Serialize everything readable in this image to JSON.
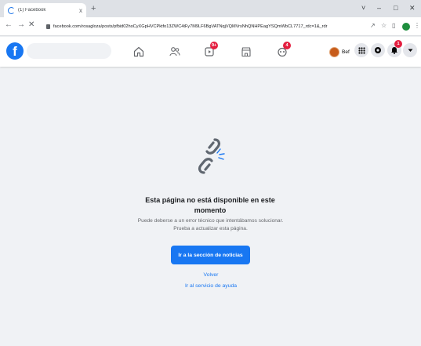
{
  "browser": {
    "tab_title": "(1) Facebook",
    "tab_close": "x",
    "new_tab": "+",
    "url": "facebook.com/rosagloza/posts/pfbid02hoCyXGpHVCPktfo13ZWC4tFy7M9LF6BgVATNqjVQMVrsNhQNHPEagYSQmWbCL7717_rdc=1&_rdr",
    "window_controls": [
      "˅",
      "–",
      "□",
      "✕"
    ]
  },
  "facebook": {
    "search_placeholder": "",
    "nav_badges": {
      "watch": "9+",
      "gaming": "4"
    },
    "user_name": "Bef",
    "notifications_badge": "1"
  },
  "error_page": {
    "title_line1": "Esta página no está disponible en este",
    "title_line2": "momento",
    "body_line1": "Puede deberse a un error técnico que intentábamos solucionar.",
    "body_line2": "Prueba a actualizar esta página.",
    "primary_button": "Ir a la sección de noticias",
    "back_link": "Volver",
    "help_link": "Ir al servicio de ayuda"
  },
  "colors": {
    "facebook_blue": "#1877f2",
    "badge_red": "#e41e3f",
    "page_background": "#f0f2f5"
  },
  "icons": {
    "nav": [
      "home-icon",
      "friends-icon",
      "watch-icon",
      "marketplace-icon",
      "gaming-icon"
    ],
    "right": [
      "menu-grid-icon",
      "messenger-icon",
      "notifications-bell-icon",
      "account-caret-icon"
    ],
    "content": "broken-link-icon"
  }
}
